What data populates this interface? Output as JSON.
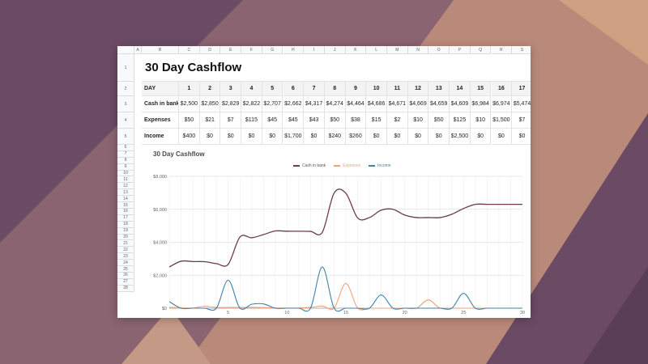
{
  "colors": {
    "cash": "#6b3b4f",
    "expenses": "#f2a277",
    "income": "#3c83a8",
    "bg_dark": "#6b4a63",
    "bg_light": "#c9987c"
  },
  "sheet": {
    "col_letters": [
      "A",
      "B",
      "C",
      "D",
      "E",
      "F",
      "G",
      "H",
      "I",
      "J",
      "K",
      "L",
      "M",
      "N",
      "O",
      "P",
      "Q",
      "R",
      "S"
    ],
    "row_numbers": [
      "1",
      "2",
      "3",
      "4",
      "5",
      "6",
      "7",
      "8",
      "9",
      "10",
      "11",
      "12",
      "13",
      "14",
      "15",
      "16",
      "17",
      "18",
      "19",
      "20",
      "21",
      "22",
      "23",
      "24",
      "25",
      "26",
      "27",
      "28"
    ],
    "title": "30 Day Cashflow",
    "day_label": "DAY",
    "days": [
      "1",
      "2",
      "3",
      "4",
      "5",
      "6",
      "7",
      "8",
      "9",
      "10",
      "11",
      "12",
      "13",
      "14",
      "15",
      "16",
      "17"
    ],
    "rows": [
      {
        "label": "Cash in bank",
        "values": [
          "$2,500",
          "$2,850",
          "$2,829",
          "$2,822",
          "$2,707",
          "$2,662",
          "$4,317",
          "$4,274",
          "$4,464",
          "$4,686",
          "$4,671",
          "$4,669",
          "$4,659",
          "$4,609",
          "$6,984",
          "$6,974",
          "$5,474"
        ]
      },
      {
        "label": "Expenses",
        "values": [
          "$50",
          "$21",
          "$7",
          "$115",
          "$45",
          "$45",
          "$43",
          "$50",
          "$38",
          "$15",
          "$2",
          "$10",
          "$50",
          "$125",
          "$10",
          "$1,500",
          "$7"
        ]
      },
      {
        "label": "Income",
        "values": [
          "$400",
          "$0",
          "$0",
          "$0",
          "$0",
          "$1,700",
          "$0",
          "$240",
          "$260",
          "$0",
          "$0",
          "$0",
          "$0",
          "$2,500",
          "$0",
          "$0",
          "$0"
        ]
      }
    ]
  },
  "chart_data": {
    "type": "line",
    "title": "30 Day Cashflow",
    "xlim": [
      0,
      30
    ],
    "ylim": [
      0,
      8000
    ],
    "x_ticks": [
      5,
      10,
      15,
      20,
      25,
      30
    ],
    "y_ticks": [
      0,
      2000,
      4000,
      6000,
      8000
    ],
    "y_tick_labels": [
      "$0",
      "$2,000",
      "$4,000",
      "$6,000",
      "$8,000"
    ],
    "grid": true,
    "legend_position": "top",
    "x": [
      0,
      1,
      2,
      3,
      4,
      5,
      6,
      7,
      8,
      9,
      10,
      11,
      12,
      13,
      14,
      15,
      16,
      17,
      18,
      19,
      20,
      21,
      22,
      23,
      24,
      25,
      26,
      27,
      28,
      29,
      30
    ],
    "series": [
      {
        "name": "Cash in bank",
        "color": "#6b3b4f",
        "values": [
          2500,
          2850,
          2829,
          2822,
          2707,
          2662,
          4317,
          4274,
          4464,
          4686,
          4671,
          4669,
          4659,
          4609,
          6984,
          6974,
          5474,
          5500,
          5950,
          6000,
          5650,
          5500,
          5500,
          5500,
          5700,
          6050,
          6300,
          6300,
          6300,
          6300,
          6300
        ]
      },
      {
        "name": "Expenses",
        "color": "#f2a277",
        "values": [
          50,
          21,
          7,
          115,
          45,
          45,
          43,
          50,
          38,
          15,
          2,
          10,
          50,
          125,
          10,
          1500,
          7,
          0,
          0,
          0,
          0,
          0,
          500,
          0,
          0,
          0,
          0,
          0,
          0,
          0,
          0
        ]
      },
      {
        "name": "Income",
        "color": "#3c83a8",
        "values": [
          400,
          0,
          0,
          0,
          0,
          1700,
          0,
          240,
          260,
          0,
          0,
          0,
          0,
          2500,
          0,
          0,
          0,
          0,
          800,
          0,
          0,
          0,
          0,
          0,
          0,
          900,
          0,
          0,
          0,
          0,
          0
        ]
      }
    ]
  }
}
